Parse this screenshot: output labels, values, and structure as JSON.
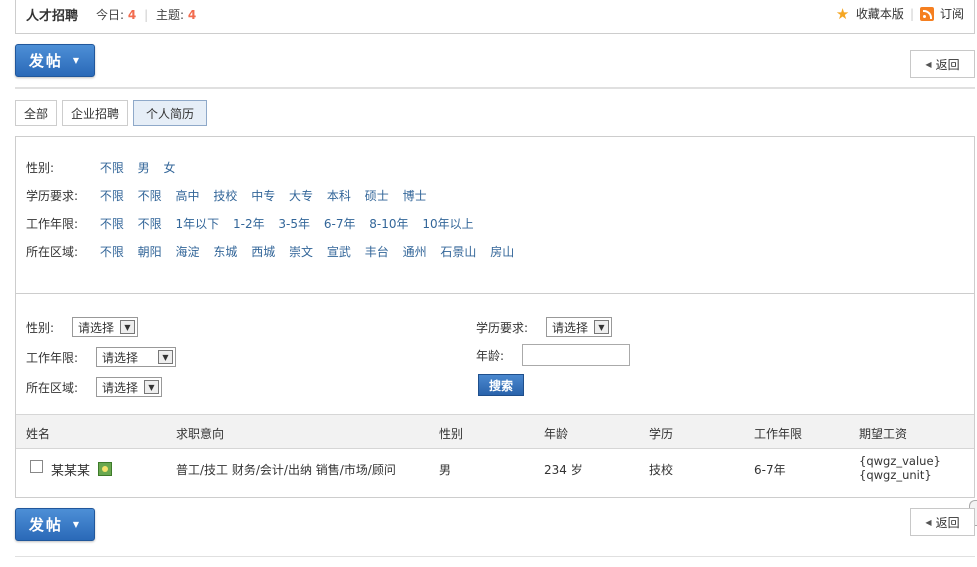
{
  "header": {
    "forum_title": "人才招聘",
    "today_label": "今日:",
    "today_count": "4",
    "topics_label": "主题:",
    "topics_count": "4",
    "favorite_label": "收藏本版",
    "subscribe_label": "订阅"
  },
  "toolbar": {
    "post_label": "发帖",
    "back_label": "返回"
  },
  "tabs": [
    {
      "label": "全部",
      "active": false
    },
    {
      "label": "企业招聘",
      "active": false
    },
    {
      "label": "个人简历",
      "active": true
    }
  ],
  "filters": {
    "gender": {
      "label": "性别:",
      "options": [
        "不限",
        "男",
        "女"
      ]
    },
    "education": {
      "label": "学历要求:",
      "options": [
        "不限",
        "不限",
        "高中",
        "技校",
        "中专",
        "大专",
        "本科",
        "硕士",
        "博士"
      ]
    },
    "experience": {
      "label": "工作年限:",
      "options": [
        "不限",
        "不限",
        "1年以下",
        "1-2年",
        "3-5年",
        "6-7年",
        "8-10年",
        "10年以上"
      ]
    },
    "district": {
      "label": "所在区域:",
      "options": [
        "不限",
        "朝阳",
        "海淀",
        "东城",
        "西城",
        "崇文",
        "宣武",
        "丰台",
        "通州",
        "石景山",
        "房山"
      ]
    }
  },
  "search_form": {
    "gender_label": "性别:",
    "gender_value": "请选择",
    "experience_label": "工作年限:",
    "experience_value": "请选择",
    "district_label": "所在区域:",
    "district_value": "请选择",
    "education_label": "学历要求:",
    "education_value": "请选择",
    "age_label": "年龄:",
    "age_value": "",
    "search_label": "搜索"
  },
  "table": {
    "columns": [
      "姓名",
      "求职意向",
      "性别",
      "年龄",
      "学历",
      "工作年限",
      "期望工资"
    ],
    "rows": [
      {
        "name": "某某某",
        "intent": "普工/技工 财务/会计/出纳 销售/市场/顾问",
        "gender": "男",
        "age": "234 岁",
        "education": "技校",
        "experience": "6-7年",
        "salary_line1": "{qwgz_value}",
        "salary_line2": "{qwgz_unit}"
      }
    ]
  },
  "colors": {
    "accent": "#2a69b8",
    "link": "#336699",
    "count": "#f26c4f"
  }
}
